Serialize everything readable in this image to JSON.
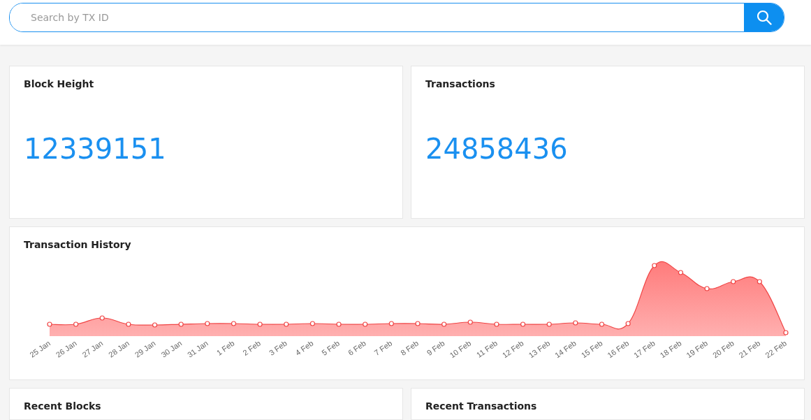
{
  "search": {
    "placeholder": "Search by TX ID"
  },
  "stats": [
    {
      "title": "Block Height",
      "value": "12339151"
    },
    {
      "title": "Transactions",
      "value": "24858436"
    }
  ],
  "history": {
    "title": "Transaction History",
    "x_labels": [
      "25 Jan",
      "26 Jan",
      "27 Jan",
      "28 Jan",
      "29 Jan",
      "30 Jan",
      "31 Jan",
      "1 Feb",
      "2 Feb",
      "3 Feb",
      "4 Feb",
      "5 Feb",
      "6 Feb",
      "7 Feb",
      "8 Feb",
      "9 Feb",
      "10 Feb",
      "11 Feb",
      "12 Feb",
      "13 Feb",
      "14 Feb",
      "15 Feb",
      "16 Feb",
      "17 Feb",
      "18 Feb",
      "19 Feb",
      "20 Feb",
      "21 Feb",
      "22 Feb"
    ]
  },
  "panels": [
    {
      "title": "Recent Blocks"
    },
    {
      "title": "Recent Transactions"
    }
  ]
}
